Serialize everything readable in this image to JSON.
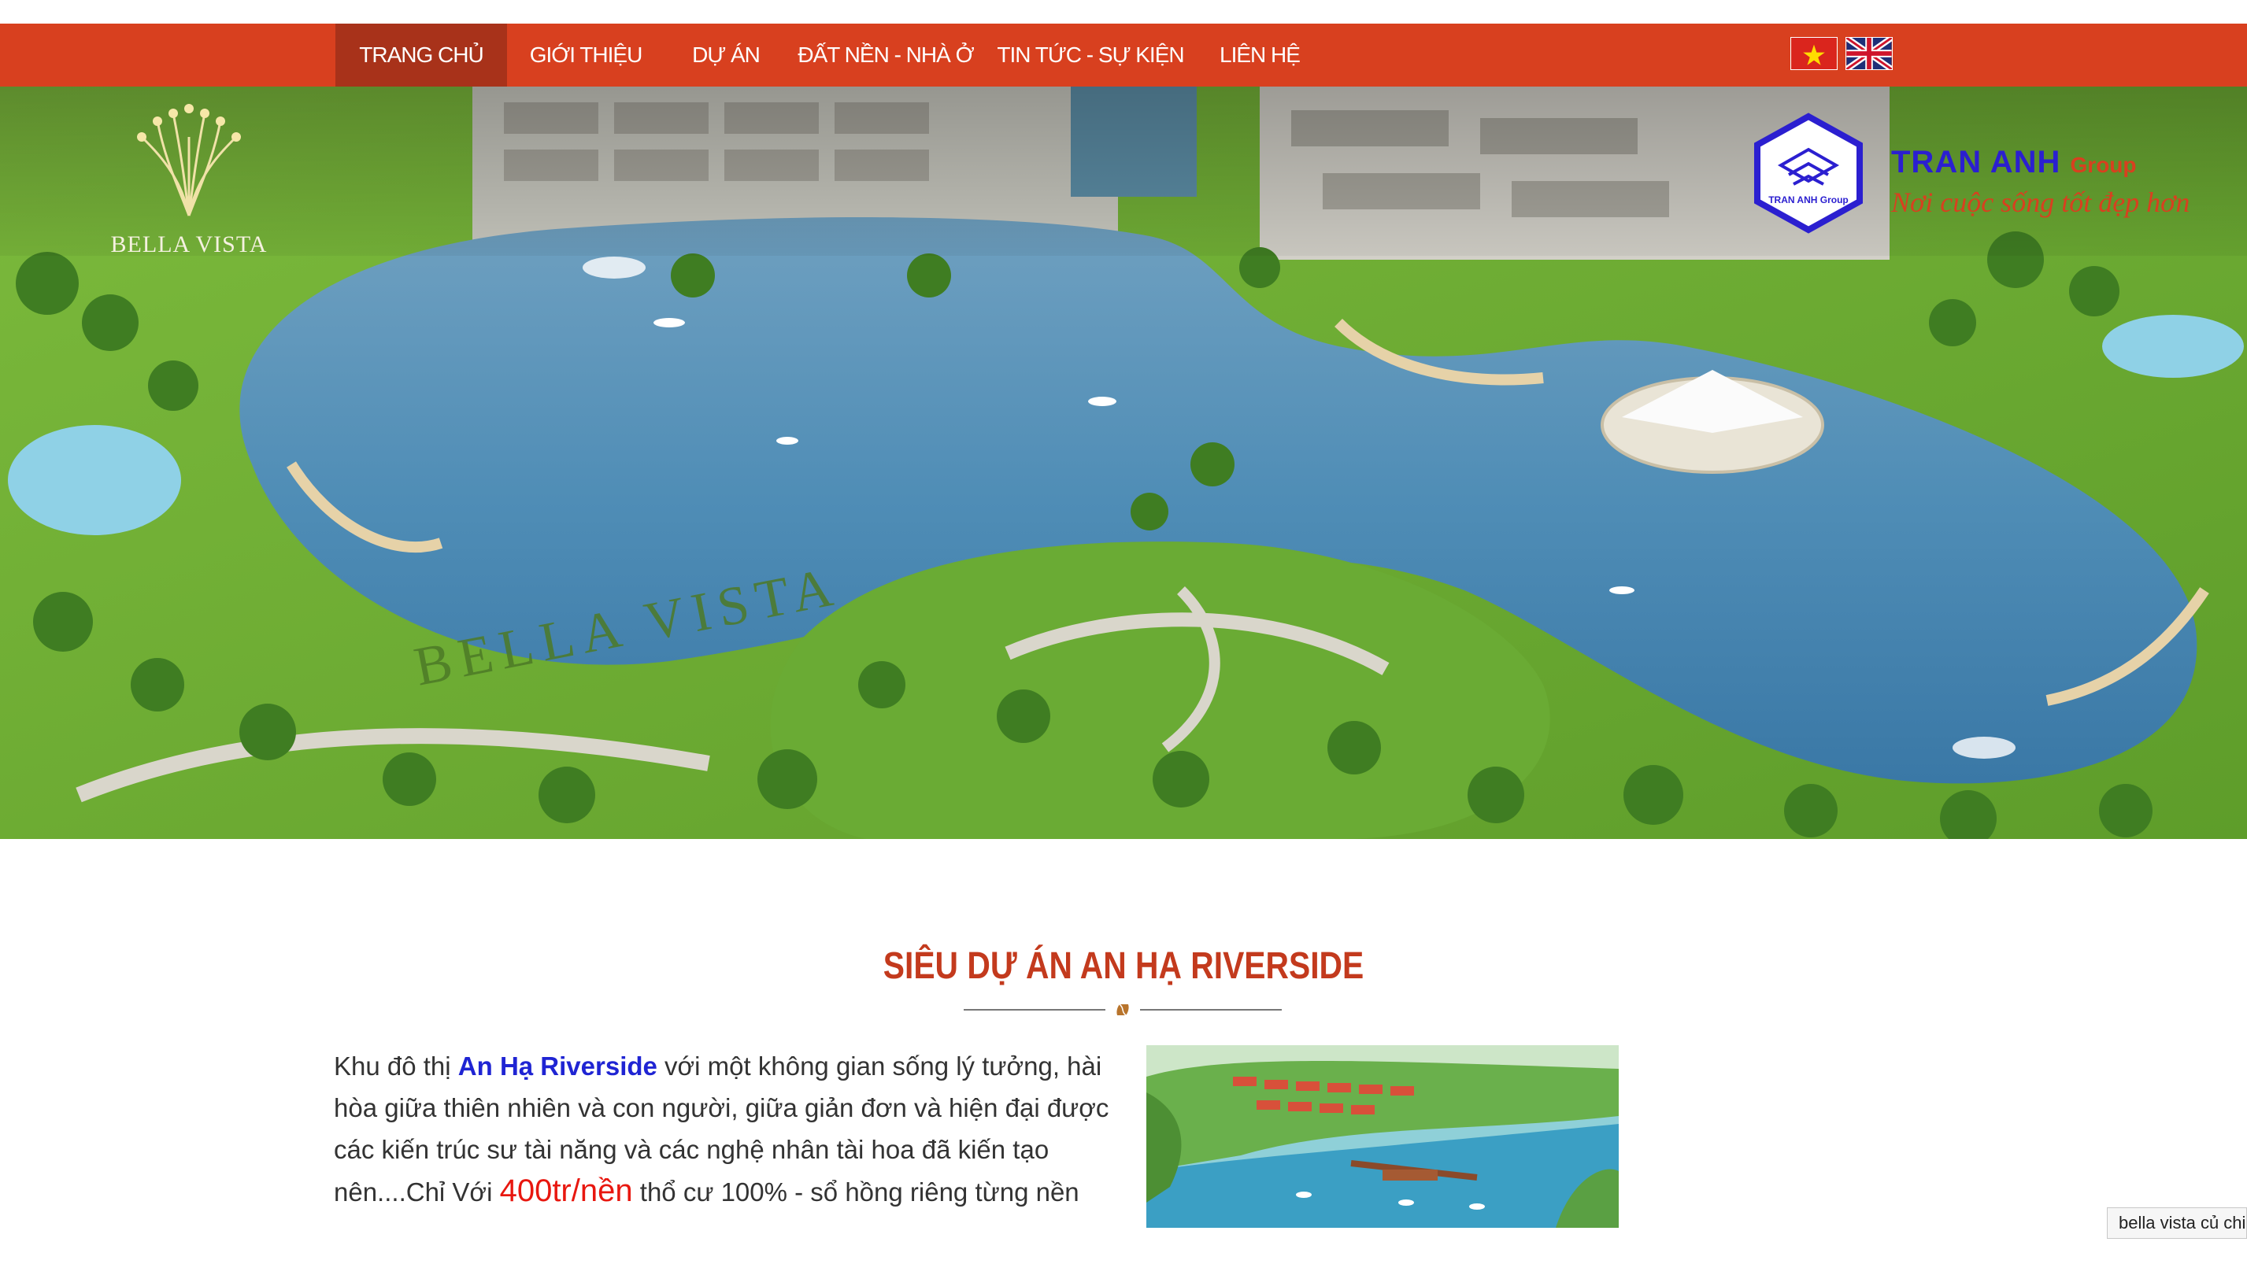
{
  "nav": {
    "items": [
      {
        "label": "TRANG CHỦ",
        "active": true
      },
      {
        "label": "GIỚI THIỆU",
        "active": false
      },
      {
        "label": "DỰ ÁN",
        "active": false
      },
      {
        "label": "ĐẤT NỀN - NHÀ Ở",
        "active": false
      },
      {
        "label": "TIN TỨC - SỰ KIỆN",
        "active": false
      },
      {
        "label": "LIÊN HỆ",
        "active": false
      }
    ],
    "flags": [
      "vietnam-flag-icon",
      "uk-flag-icon"
    ]
  },
  "hero": {
    "brand_logo_text": "BELLA VISTA",
    "lawn_text": "BELLA VISTA",
    "company_name": "TRAN ANH",
    "company_group": "Group",
    "company_slogan": "Nơi cuộc sống tốt đẹp hơn",
    "company_logo_inner_text": "TRAN ANH Group"
  },
  "section": {
    "title": "SIÊU DỰ ÁN AN HẠ RIVERSIDE",
    "intro_pre": "Khu đô thị ",
    "intro_highlight": "An Hạ Riverside",
    "intro_mid": " với một không gian sống lý tưởng, hài hòa giữa thiên nhiên và con người, giữa giản đơn và hiện đại được các kiến trúc sư tài năng và các nghệ nhân tài hoa đã kiến tạo nên....Chỉ Với ",
    "intro_price": "400tr/nền",
    "intro_post": "  thổ cư 100% - sổ hồng riêng từng nền"
  },
  "tooltip": {
    "text": "bella vista củ chi"
  },
  "colors": {
    "nav_bg": "#d8401f",
    "nav_active_bg": "#a8321a",
    "title_red": "#c33a1d",
    "highlight_blue": "#1f24d3",
    "price_red": "#e8170f"
  }
}
